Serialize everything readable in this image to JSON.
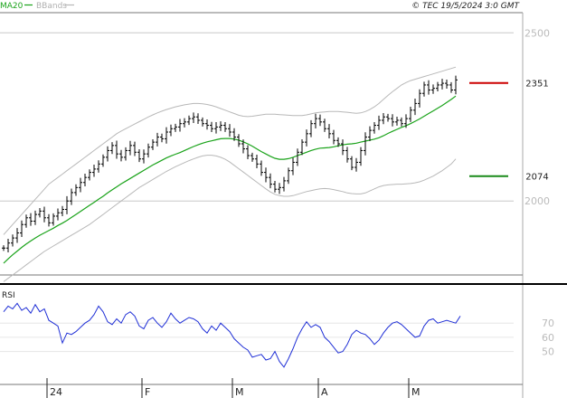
{
  "header": {
    "ma_legend": "MA20",
    "bb_legend": "BBands",
    "credit": "© TEC 19/5/2024 3:0 GMT"
  },
  "colors": {
    "ma": "#1aa31a",
    "bands": "#b8b8b8",
    "price": "#000000",
    "rsi": "#1f2fd6",
    "resistance": "#cc0000",
    "support": "#1a8a1a",
    "grid": "#c8c8c8",
    "axis": "#777777"
  },
  "chart_data": [
    {
      "type": "line",
      "panel": "price",
      "ylim": [
        1780,
        2560
      ],
      "yticks": [
        2000,
        2500
      ],
      "ytick_labels": [
        "2000",
        "2500"
      ],
      "levels": [
        {
          "label": "2351",
          "value": 2351,
          "color": "#cc0000"
        },
        {
          "label": "2074",
          "value": 2074,
          "color": "#1a8a1a"
        }
      ],
      "months": [
        {
          "label": "24",
          "index": 10
        },
        {
          "label": "F",
          "index": 31
        },
        {
          "label": "M",
          "index": 51
        },
        {
          "label": "A",
          "index": 70
        },
        {
          "label": "M",
          "index": 90
        }
      ],
      "closes": [
        1860,
        1875,
        1890,
        1905,
        1930,
        1950,
        1940,
        1960,
        1970,
        1950,
        1935,
        1955,
        1965,
        1975,
        2000,
        2025,
        2040,
        2055,
        2070,
        2085,
        2095,
        2110,
        2130,
        2150,
        2165,
        2140,
        2130,
        2150,
        2165,
        2145,
        2125,
        2140,
        2160,
        2175,
        2190,
        2185,
        2205,
        2215,
        2220,
        2230,
        2235,
        2245,
        2250,
        2240,
        2230,
        2225,
        2215,
        2220,
        2225,
        2215,
        2205,
        2190,
        2170,
        2155,
        2135,
        2125,
        2110,
        2085,
        2070,
        2050,
        2035,
        2040,
        2060,
        2090,
        2115,
        2145,
        2175,
        2200,
        2230,
        2245,
        2235,
        2215,
        2200,
        2180,
        2170,
        2150,
        2125,
        2100,
        2115,
        2150,
        2190,
        2210,
        2225,
        2240,
        2250,
        2245,
        2235,
        2240,
        2230,
        2245,
        2270,
        2290,
        2320,
        2345,
        2330,
        2335,
        2345,
        2350,
        2345,
        2330,
        2360
      ],
      "ma20": [
        1815,
        1828,
        1840,
        1851,
        1862,
        1872,
        1881,
        1890,
        1898,
        1905,
        1912,
        1919,
        1927,
        1934,
        1942,
        1951,
        1960,
        1969,
        1978,
        1987,
        1996,
        2005,
        2014,
        2024,
        2033,
        2042,
        2051,
        2059,
        2067,
        2075,
        2083,
        2091,
        2099,
        2107,
        2114,
        2121,
        2128,
        2134,
        2139,
        2144,
        2150,
        2156,
        2162,
        2167,
        2172,
        2176,
        2179,
        2182,
        2185,
        2186,
        2186,
        2184,
        2181,
        2176,
        2170,
        2163,
        2155,
        2147,
        2140,
        2133,
        2127,
        2124,
        2124,
        2126,
        2130,
        2135,
        2140,
        2145,
        2150,
        2154,
        2157,
        2158,
        2159,
        2161,
        2164,
        2167,
        2169,
        2170,
        2172,
        2175,
        2178,
        2181,
        2184,
        2188,
        2194,
        2201,
        2207,
        2213,
        2219,
        2224,
        2230,
        2237,
        2244,
        2252,
        2260,
        2268,
        2276,
        2284,
        2293,
        2302,
        2312
      ],
      "bb_upper": [
        1900,
        1915,
        1930,
        1945,
        1960,
        1975,
        1990,
        2005,
        2020,
        2035,
        2050,
        2060,
        2070,
        2080,
        2090,
        2100,
        2110,
        2120,
        2130,
        2140,
        2150,
        2160,
        2170,
        2180,
        2190,
        2200,
        2208,
        2215,
        2222,
        2229,
        2236,
        2243,
        2250,
        2256,
        2262,
        2267,
        2272,
        2276,
        2280,
        2283,
        2286,
        2288,
        2290,
        2290,
        2289,
        2287,
        2284,
        2280,
        2275,
        2270,
        2265,
        2260,
        2255,
        2252,
        2251,
        2252,
        2254,
        2256,
        2258,
        2258,
        2258,
        2257,
        2256,
        2255,
        2254,
        2254,
        2254,
        2256,
        2259,
        2262,
        2264,
        2265,
        2266,
        2266,
        2266,
        2265,
        2264,
        2262,
        2261,
        2262,
        2266,
        2272,
        2280,
        2290,
        2302,
        2314,
        2325,
        2335,
        2345,
        2352,
        2358,
        2362,
        2366,
        2370,
        2374,
        2378,
        2382,
        2386,
        2390,
        2394,
        2398
      ],
      "bb_lower": [
        1760,
        1770,
        1780,
        1790,
        1800,
        1810,
        1820,
        1830,
        1840,
        1850,
        1858,
        1866,
        1874,
        1882,
        1890,
        1898,
        1906,
        1914,
        1922,
        1930,
        1940,
        1950,
        1960,
        1970,
        1980,
        1990,
        2000,
        2010,
        2020,
        2030,
        2040,
        2048,
        2056,
        2064,
        2072,
        2080,
        2088,
        2095,
        2102,
        2108,
        2114,
        2120,
        2125,
        2130,
        2134,
        2136,
        2136,
        2134,
        2130,
        2124,
        2116,
        2106,
        2096,
        2086,
        2076,
        2066,
        2056,
        2046,
        2036,
        2027,
        2020,
        2016,
        2014,
        2014,
        2016,
        2020,
        2024,
        2028,
        2031,
        2034,
        2036,
        2037,
        2036,
        2034,
        2031,
        2028,
        2024,
        2022,
        2021,
        2021,
        2024,
        2030,
        2036,
        2042,
        2046,
        2048,
        2049,
        2050,
        2050,
        2051,
        2052,
        2054,
        2057,
        2062,
        2068,
        2074,
        2082,
        2090,
        2100,
        2110,
        2125
      ]
    },
    {
      "type": "line",
      "panel": "rsi",
      "title": "RSI",
      "ylim": [
        30,
        95
      ],
      "yticks": [
        50,
        60,
        70
      ],
      "ytick_labels": [
        "50",
        "60",
        "70"
      ],
      "values": [
        78,
        82,
        80,
        84,
        79,
        81,
        77,
        83,
        78,
        80,
        72,
        70,
        68,
        56,
        63,
        62,
        64,
        67,
        70,
        72,
        76,
        82,
        78,
        71,
        69,
        73,
        70,
        76,
        78,
        75,
        68,
        66,
        72,
        74,
        70,
        67,
        71,
        77,
        73,
        70,
        72,
        74,
        73,
        71,
        66,
        63,
        68,
        65,
        70,
        67,
        64,
        59,
        56,
        53,
        51,
        46,
        47,
        48,
        44,
        45,
        50,
        43,
        39,
        45,
        52,
        60,
        66,
        71,
        67,
        69,
        67,
        60,
        57,
        53,
        49,
        50,
        55,
        62,
        65,
        63,
        62,
        59,
        55,
        58,
        63,
        67,
        70,
        71,
        69,
        66,
        63,
        60,
        61,
        68,
        72,
        73,
        70,
        71,
        72,
        71,
        70,
        75
      ]
    }
  ]
}
